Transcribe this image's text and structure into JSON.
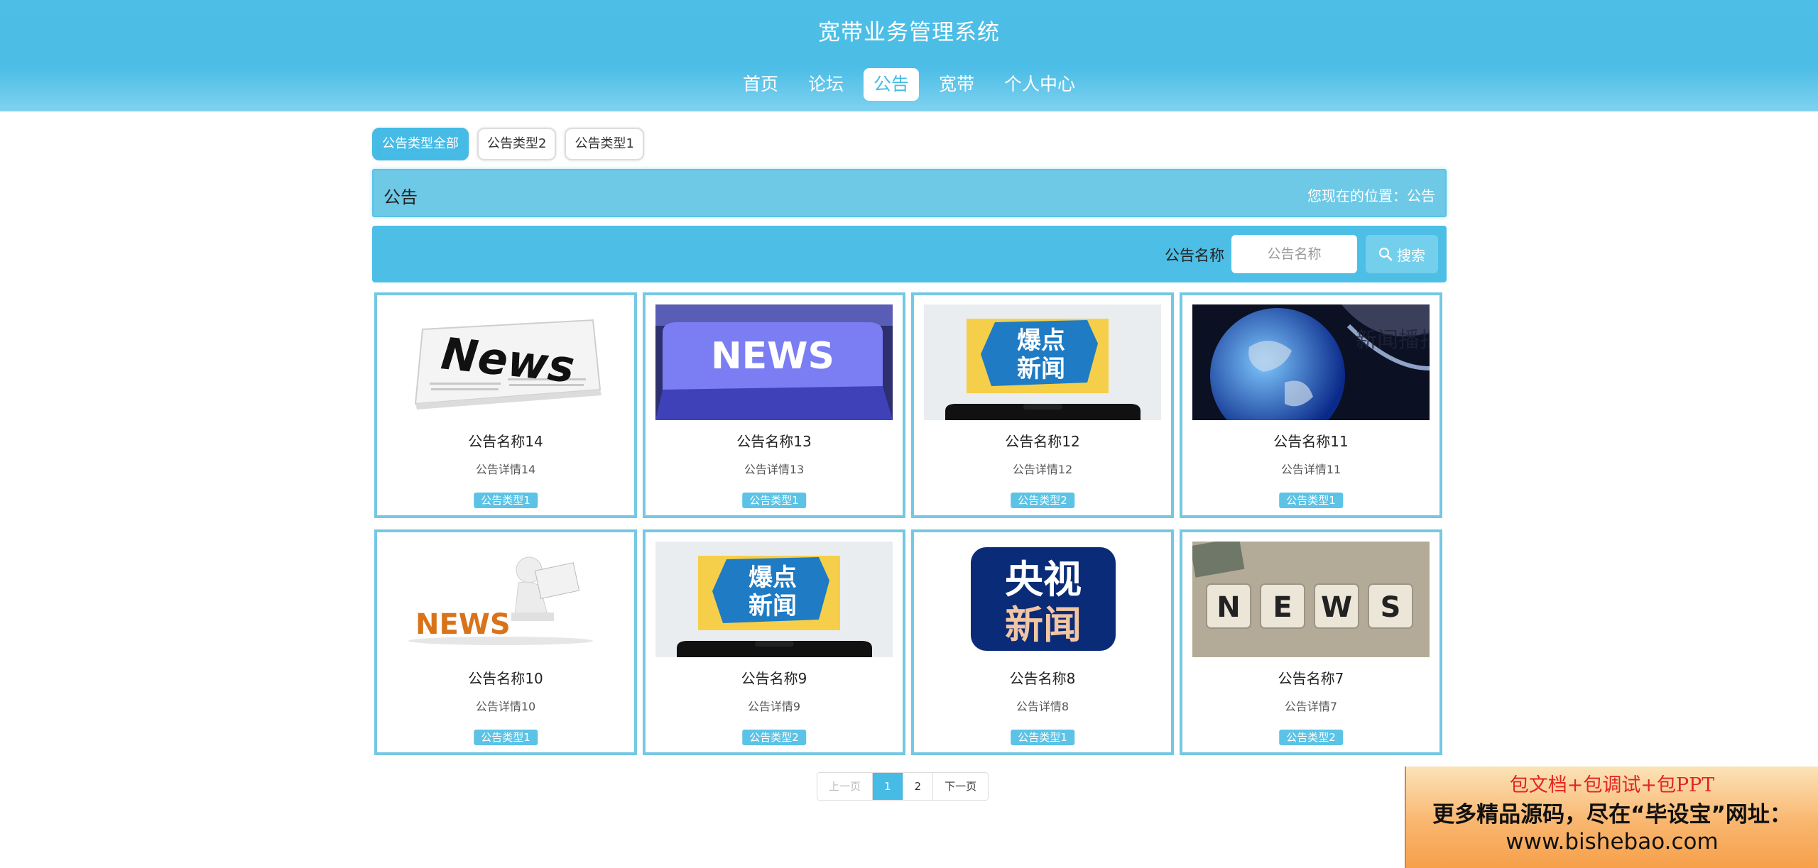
{
  "header": {
    "title": "宽带业务管理系统",
    "nav": [
      "首页",
      "论坛",
      "公告",
      "宽带",
      "个人中心"
    ],
    "active_nav": "公告"
  },
  "type_tabs": [
    "公告类型全部",
    "公告类型2",
    "公告类型1"
  ],
  "crumb": {
    "title": "公告",
    "location": "您现在的位置：公告"
  },
  "search": {
    "label": "公告名称",
    "placeholder": "公告名称",
    "button": "搜索"
  },
  "cards": [
    {
      "name": "公告名称14",
      "detail": "公告详情14",
      "type": "公告类型1",
      "image": "news-newspaper"
    },
    {
      "name": "公告名称13",
      "detail": "公告详情13",
      "type": "公告类型1",
      "image": "news-keyboard-key"
    },
    {
      "name": "公告名称12",
      "detail": "公告详情12",
      "type": "公告类型2",
      "image": "hot-news-phone"
    },
    {
      "name": "公告名称11",
      "detail": "公告详情11",
      "type": "公告类型1",
      "image": "news-broadcast-globe"
    },
    {
      "name": "公告名称10",
      "detail": "公告详情10",
      "type": "公告类型1",
      "image": "news-3d-figure"
    },
    {
      "name": "公告名称9",
      "detail": "公告详情9",
      "type": "公告类型2",
      "image": "hot-news-phone"
    },
    {
      "name": "公告名称8",
      "detail": "公告详情8",
      "type": "公告类型1",
      "image": "cctv-news-logo"
    },
    {
      "name": "公告名称7",
      "detail": "公告详情7",
      "type": "公告类型2",
      "image": "news-dice-blocks"
    }
  ],
  "image_text": {
    "news_word": "News",
    "news_caps": "NEWS",
    "hot_line1": "爆点",
    "hot_line2": "新闻",
    "broadcast": "新闻播报",
    "cctv_line1": "央视",
    "cctv_line2": "新闻",
    "news_letters": [
      "N",
      "E",
      "W",
      "S"
    ]
  },
  "pager": {
    "prev": "上一页",
    "pages": [
      "1",
      "2"
    ],
    "current": "1",
    "next": "下一页"
  },
  "ad": {
    "line1": "包文档+包调试+包PPT",
    "line2": "更多精品源码，尽在“毕设宝”网址：",
    "line3": "www.bishebao.com"
  },
  "colors": {
    "primary": "#45bbe6",
    "card_border": "#74c8e3",
    "ad_red": "#e2241f"
  }
}
